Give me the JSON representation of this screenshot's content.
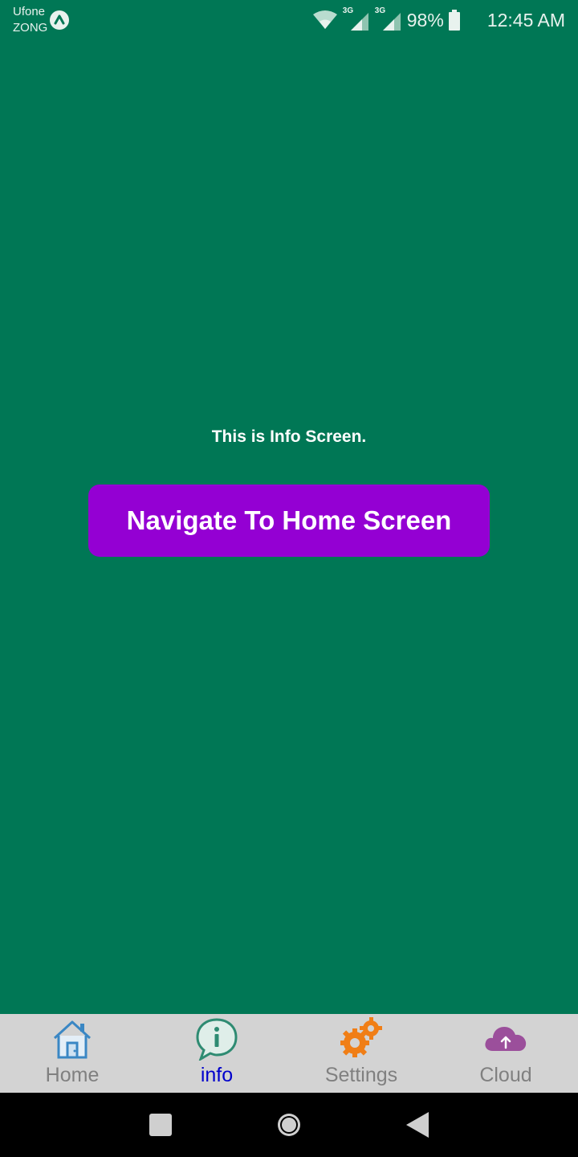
{
  "status_bar": {
    "carrier_1": "Ufone",
    "carrier_2": "ZONG",
    "network_1": "3G",
    "network_2": "3G",
    "battery": "98%",
    "time": "12:45 AM"
  },
  "main": {
    "message": "This is Info Screen.",
    "button_label": "Navigate To Home Screen",
    "colors": {
      "background": "#007755",
      "button": "#9400D3"
    }
  },
  "tabs": [
    {
      "label": "Home",
      "icon": "home-icon",
      "active": false
    },
    {
      "label": "info",
      "icon": "info-icon",
      "active": true
    },
    {
      "label": "Settings",
      "icon": "gears-icon",
      "active": false
    },
    {
      "label": "Cloud",
      "icon": "cloud-upload-icon",
      "active": false
    }
  ],
  "system_nav": {
    "buttons": [
      "recents-button",
      "home-button",
      "back-button"
    ]
  }
}
